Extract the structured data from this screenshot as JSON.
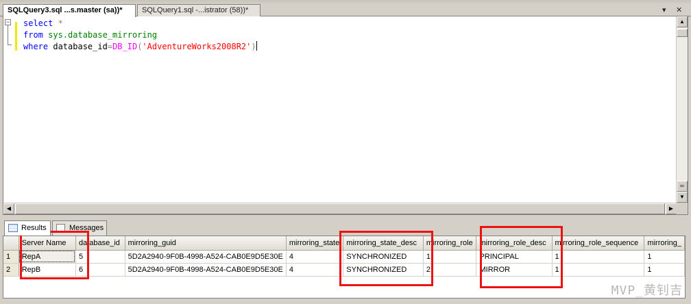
{
  "tabs": [
    {
      "label": "SQLQuery3.sql ...s.master (sa))*"
    },
    {
      "label": "SQLQuery1.sql -...istrator (58))*"
    }
  ],
  "window_controls": {
    "dropdown": "▾",
    "close": "✕"
  },
  "editor": {
    "code": {
      "line1_kw": "select",
      "line1_rest": " *",
      "line2_kw": "from",
      "line2_obj": " sys.database_mirroring",
      "line3_kw": "where",
      "line3_col": " database_id",
      "line3_eq": "=",
      "line3_fn": "DB_ID",
      "line3_open": "(",
      "line3_str": "'AdventureWorks2008R2'",
      "line3_close": ")"
    }
  },
  "results_tabs": {
    "results": "Results",
    "messages": "Messages"
  },
  "grid": {
    "columns": [
      "Server Name",
      "database_id",
      "mirroring_guid",
      "mirroring_state",
      "mirroring_state_desc",
      "mirroring_role",
      "mirroring_role_desc",
      "mirroring_role_sequence",
      "mirroring_"
    ],
    "rows": [
      {
        "num": "1",
        "server": "RepA",
        "database_id": "5",
        "guid": "5D2A2940-9F0B-4998-A524-CAB0E9D5E30E",
        "state": "4",
        "state_desc": "SYNCHRONIZED",
        "role": "1",
        "role_desc": "PRINCIPAL",
        "role_seq": "1",
        "more": "1"
      },
      {
        "num": "2",
        "server": "RepB",
        "database_id": "6",
        "guid": "5D2A2940-9F0B-4998-A524-CAB0E9D5E30E",
        "state": "4",
        "state_desc": "SYNCHRONIZED",
        "role": "2",
        "role_desc": "MIRROR",
        "role_seq": "1",
        "more": "1"
      }
    ]
  },
  "watermark": "MVP_黄钊吉",
  "colors": {
    "highlight_box": "#ee1111",
    "keyword": "#0000ff",
    "system_object": "#008000",
    "function": "#ff00ff",
    "string": "#ff0000"
  }
}
